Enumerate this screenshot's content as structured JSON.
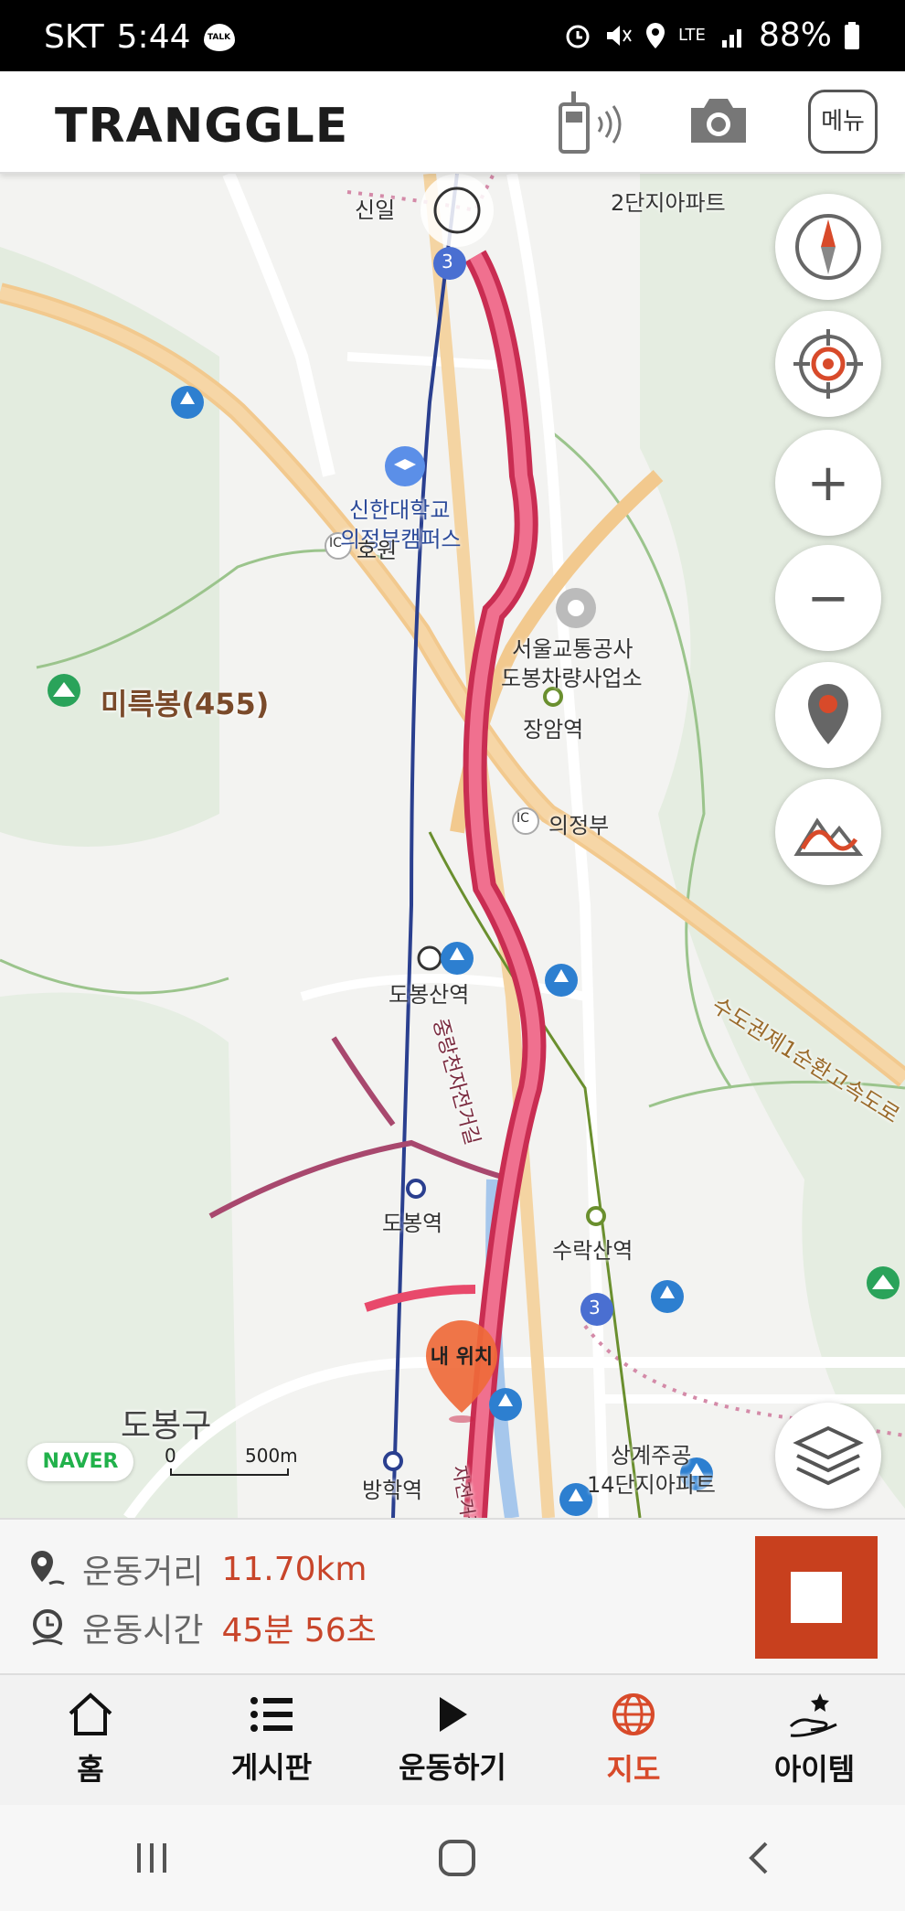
{
  "status_bar": {
    "carrier": "SKT",
    "time": "5:44",
    "talk_badge": "TALK",
    "network": "LTE",
    "battery": "88%"
  },
  "header": {
    "logo": "TRANGGLE",
    "menu_label": "메뉴"
  },
  "map": {
    "labels": {
      "apartment_top": "2단지아파트",
      "station_top": "신일",
      "university": "신한대학교",
      "campus": "의정부캠퍼스",
      "ic_left": "IC",
      "ic_left_name": "호원",
      "seoul_transport": "서울교통공사",
      "dobong_depot": "도봉차량사업소",
      "mountain": "미륵봉(455)",
      "jangam_station": "장암역",
      "ic_right": "IC",
      "ic_right_name": "의정부",
      "dobongsan_station": "도봉산역",
      "highway": "수도권제1순환고속도로",
      "bike_road": "중랑천자전거길",
      "dobong_station": "도봉역",
      "surak_station": "수락산역",
      "district": "도봉구",
      "banghak_station": "방학역",
      "sanggye_apt_1": "상계주공",
      "sanggye_apt_2": "14단지아파트",
      "bike_road_bottom": "자전거길",
      "route_3_top": "3",
      "route_3_bottom": "3"
    },
    "my_location_label": "내 위치",
    "naver_badge": "NAVER",
    "scale": {
      "zero": "0",
      "distance": "500m"
    }
  },
  "controls": {
    "compass": "compass-icon",
    "locate": "crosshair-icon",
    "zoom_in": "+",
    "zoom_out": "−",
    "pin": "map-pin-icon",
    "elevation": "mountain-icon",
    "layers": "layers-icon"
  },
  "stats": {
    "distance_label": "운동거리",
    "distance_value": "11.70km",
    "time_label": "운동시간",
    "time_value": "45분 56초"
  },
  "tabs": [
    {
      "label": "홈",
      "icon": "home-icon"
    },
    {
      "label": "게시판",
      "icon": "list-icon"
    },
    {
      "label": "운동하기",
      "icon": "play-icon"
    },
    {
      "label": "지도",
      "icon": "globe-icon",
      "active": true
    },
    {
      "label": "아이템",
      "icon": "gift-hand-icon"
    }
  ],
  "colors": {
    "accent": "#c8401e",
    "route": "#e8496b",
    "active_tab": "#d84a2a"
  }
}
